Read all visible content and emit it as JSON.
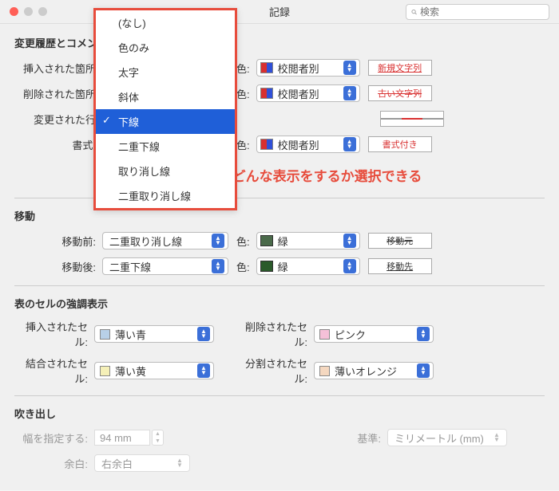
{
  "window": {
    "title": "記録",
    "search_placeholder": "検索"
  },
  "labels": {
    "color": "色:"
  },
  "annotation": "変更した内容でどんな表示をするか選択できる",
  "dropdown": {
    "items": [
      "(なし)",
      "色のみ",
      "太字",
      "斜体",
      "下線",
      "二重下線",
      "取り消し線",
      "二重取り消し線"
    ],
    "selected_index": 4
  },
  "sections": {
    "history": {
      "title": "変更履歴とコメント",
      "inserted": {
        "label": "挿入された箇所",
        "mark": "下線",
        "color": "校閲者別",
        "preview": "新規文字列"
      },
      "deleted": {
        "label": "削除された箇所",
        "mark": "取り消し線",
        "color": "校閲者別",
        "preview": "古い文字列"
      },
      "changed": {
        "label": "変更された行"
      },
      "format": {
        "label": "書式:",
        "mark": "(なし)",
        "color": "校閲者別",
        "preview": "書式付き"
      }
    },
    "move": {
      "title": "移動",
      "from": {
        "label": "移動前:",
        "mark": "二重取り消し線",
        "color": "緑",
        "preview": "移動元"
      },
      "to": {
        "label": "移動後:",
        "mark": "二重下線",
        "color": "緑",
        "preview": "移動先"
      }
    },
    "cells": {
      "title": "表のセルの強調表示",
      "inserted": {
        "label": "挿入されたセル:",
        "color": "薄い青"
      },
      "deleted": {
        "label": "削除されたセル:",
        "color": "ピンク"
      },
      "merged": {
        "label": "結合されたセル:",
        "color": "薄い黄"
      },
      "split": {
        "label": "分割されたセル:",
        "color": "薄いオレンジ"
      }
    },
    "balloon": {
      "title": "吹き出し",
      "width": {
        "label": "幅を指定する:",
        "value": "94 mm"
      },
      "unit": {
        "label": "基準:",
        "value": "ミリメートル (mm)"
      },
      "margin": {
        "label": "余白:",
        "value": "右余白"
      }
    }
  }
}
